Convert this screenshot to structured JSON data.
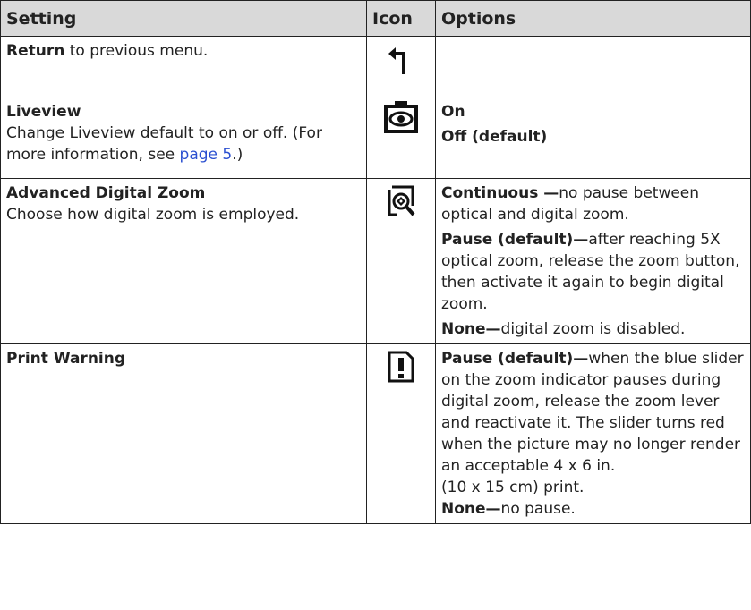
{
  "header": {
    "setting": "Setting",
    "icon": "Icon",
    "options": "Options"
  },
  "rows": [
    {
      "title": "Return",
      "desc": " to previous menu.",
      "icon": "return-arrow-icon",
      "options": []
    },
    {
      "title": "Liveview",
      "desc_pre": "Change Liveview default to on or off. (For more information, see ",
      "link": "page 5",
      "desc_post": ".)",
      "icon": "liveview-camera-icon",
      "options": [
        {
          "label": "On",
          "text": ""
        },
        {
          "label": "Off (default)",
          "text": ""
        }
      ]
    },
    {
      "title": "Advanced Digital Zoom",
      "desc": "Choose how digital zoom is employed.",
      "icon": "digital-zoom-icon",
      "options": [
        {
          "label": "Continuous —",
          "text": "no pause between optical and digital zoom."
        },
        {
          "label": "Pause (default)—",
          "text": "after reaching 5X optical zoom, release the zoom button, then activate it again to begin digital zoom."
        },
        {
          "label": "None—",
          "text": "digital zoom is disabled."
        }
      ]
    },
    {
      "title": "Print Warning",
      "desc": "",
      "icon": "print-warning-icon",
      "options": [
        {
          "label": "Pause (default)—",
          "text": "when the blue slider on the zoom indicator pauses during digital zoom, release the zoom lever and reactivate it. The slider turns red when the picture may no longer render an acceptable 4 x 6 in.",
          "extra": "(10 x 15 cm) print."
        },
        {
          "label": "None—",
          "text": "no pause."
        }
      ]
    }
  ],
  "colors": {
    "header_bg": "#d9d9d9",
    "link": "#2a4fd0",
    "icon": "#111111"
  }
}
